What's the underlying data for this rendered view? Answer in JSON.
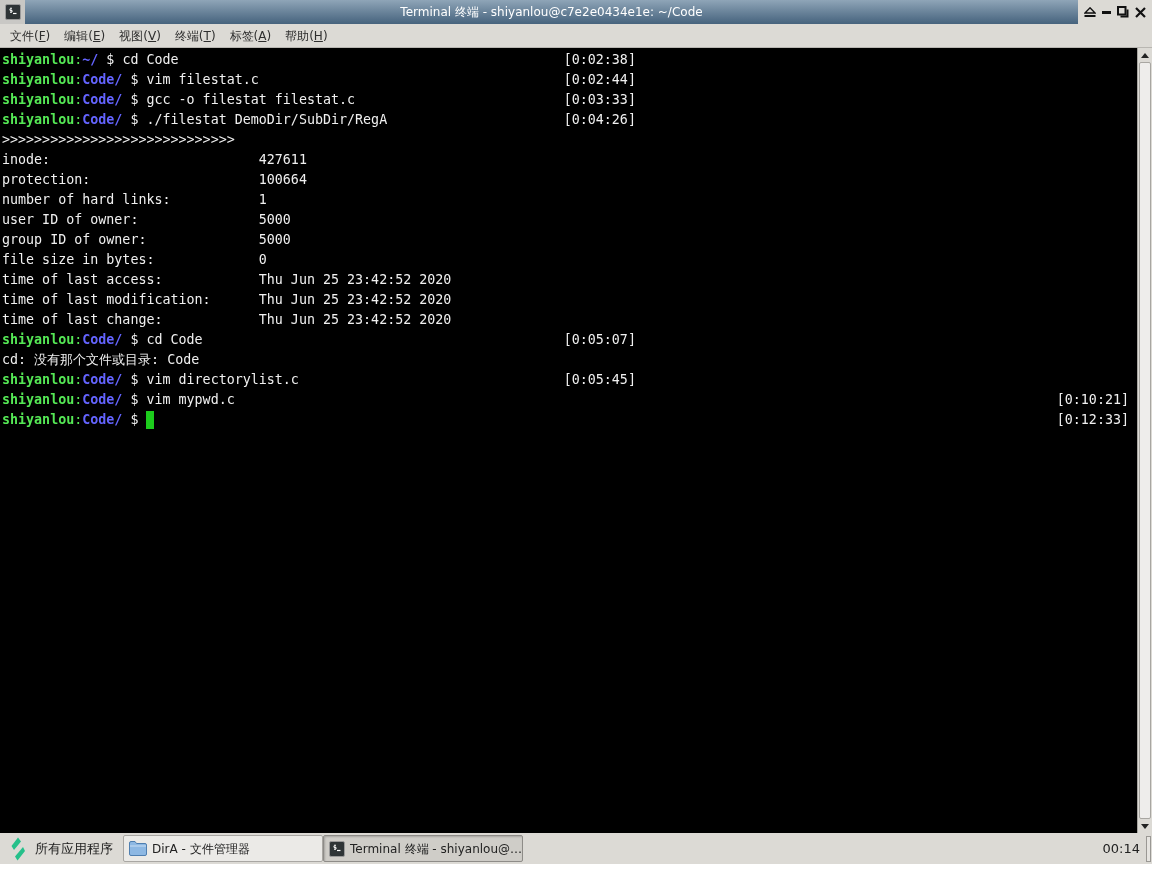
{
  "window": {
    "title": "Terminal 终端 - shiyanlou@c7e2e0434e1e: ~/Code"
  },
  "menu": [
    {
      "before": "文件(",
      "mnemonic": "F",
      "after": ")"
    },
    {
      "before": "编辑(",
      "mnemonic": "E",
      "after": ")"
    },
    {
      "before": "视图(",
      "mnemonic": "V",
      "after": ")"
    },
    {
      "before": "终端(",
      "mnemonic": "T",
      "after": ")"
    },
    {
      "before": "标签(",
      "mnemonic": "A",
      "after": ")"
    },
    {
      "before": "帮助(",
      "mnemonic": "H",
      "after": ")"
    }
  ],
  "terminal": {
    "lines": [
      {
        "kind": "prompt",
        "user": "shiyanlou",
        "separator": ":",
        "dir": "~/",
        "symbol": "$",
        "command": "cd Code",
        "time": "[0:02:38]",
        "full_width": false,
        "cursor": false
      },
      {
        "kind": "prompt",
        "user": "shiyanlou",
        "separator": ":",
        "dir": "Code/",
        "symbol": "$",
        "command": "vim filestat.c",
        "time": "[0:02:44]",
        "full_width": false,
        "cursor": false
      },
      {
        "kind": "prompt",
        "user": "shiyanlou",
        "separator": ":",
        "dir": "Code/",
        "symbol": "$",
        "command": "gcc -o filestat filestat.c",
        "time": "[0:03:33]",
        "full_width": false,
        "cursor": false
      },
      {
        "kind": "prompt",
        "user": "shiyanlou",
        "separator": ":",
        "dir": "Code/",
        "symbol": "$",
        "command": "./filestat DemoDir/SubDir/RegA",
        "time": "[0:04:26]",
        "full_width": false,
        "cursor": false
      },
      {
        "kind": "output",
        "text": ">>>>>>>>>>>>>>>>>>>>>>>>>>>>>"
      },
      {
        "kind": "field",
        "label": "inode:",
        "value": "427611"
      },
      {
        "kind": "field",
        "label": "protection:",
        "value": "100664"
      },
      {
        "kind": "field",
        "label": "number of hard links:",
        "value": "1"
      },
      {
        "kind": "field",
        "label": "user ID of owner:",
        "value": "5000"
      },
      {
        "kind": "field",
        "label": "group ID of owner:",
        "value": "5000"
      },
      {
        "kind": "field",
        "label": "file size in bytes:",
        "value": "0"
      },
      {
        "kind": "field",
        "label": "time of last access:",
        "value": "Thu Jun 25 23:42:52 2020"
      },
      {
        "kind": "field",
        "label": "time of last modification:",
        "value": "Thu Jun 25 23:42:52 2020"
      },
      {
        "kind": "field",
        "label": "time of last change:",
        "value": "Thu Jun 25 23:42:52 2020"
      },
      {
        "kind": "prompt",
        "user": "shiyanlou",
        "separator": ":",
        "dir": "Code/",
        "symbol": "$",
        "command": "cd Code",
        "time": "[0:05:07]",
        "full_width": false,
        "cursor": false
      },
      {
        "kind": "output",
        "text": "cd: 没有那个文件或目录: Code"
      },
      {
        "kind": "prompt",
        "user": "shiyanlou",
        "separator": ":",
        "dir": "Code/",
        "symbol": "$",
        "command": "vim directorylist.c",
        "time": "[0:05:45]",
        "full_width": false,
        "cursor": false
      },
      {
        "kind": "prompt",
        "user": "shiyanlou",
        "separator": ":",
        "dir": "Code/",
        "symbol": "$",
        "command": "vim mypwd.c",
        "time": "[0:10:21]",
        "full_width": true,
        "cursor": false
      },
      {
        "kind": "prompt",
        "user": "shiyanlou",
        "separator": ":",
        "dir": "Code/",
        "symbol": "$",
        "time": "[0:12:33]",
        "full_width": true,
        "cursor": true
      }
    ]
  },
  "taskbar": {
    "start": {
      "label": "所有应用程序"
    },
    "tasks": [
      {
        "kind": "folder",
        "label": "DirA - 文件管理器",
        "selected": false
      },
      {
        "kind": "terminal",
        "label": "Terminal 终端 - shiyanlou@…",
        "selected": true
      }
    ],
    "clock": "00:14"
  }
}
